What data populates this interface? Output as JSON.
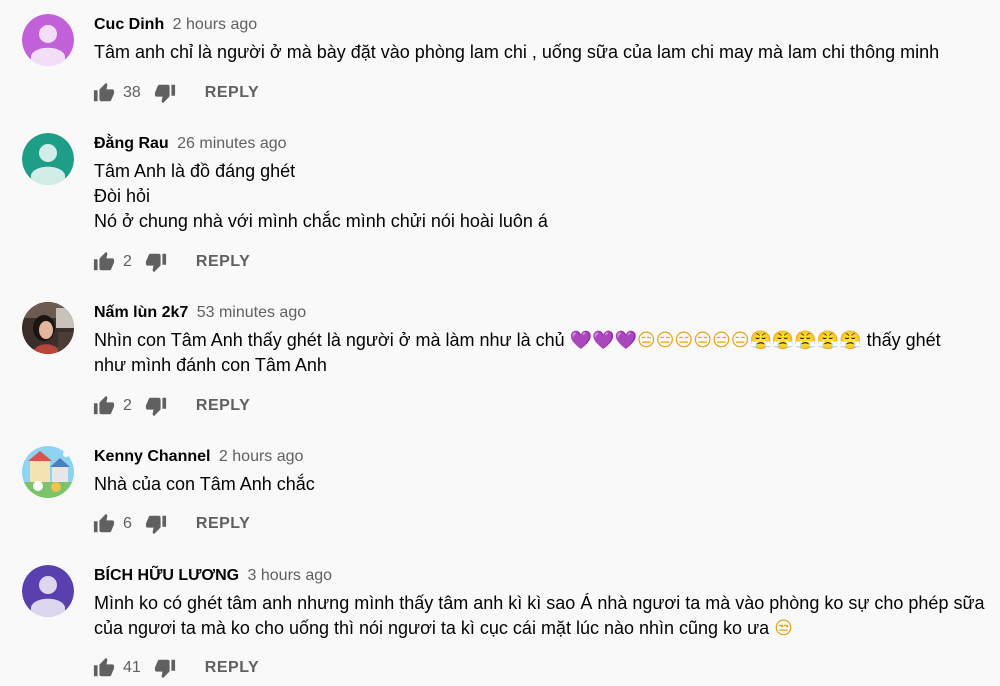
{
  "comments": [
    {
      "author": "Cuc Dinh",
      "time": "2 hours ago",
      "lines": [
        "Tâm anh chỉ là người ở mà bày  đặt vào phòng lam chi , uống sữa của lam chi may mà lam chi thông minh"
      ],
      "likes": "38",
      "reply": "REPLY",
      "avatar": {
        "type": "default",
        "bg": "#c160d8",
        "fg": "#f2def7"
      }
    },
    {
      "author": "Đằng Rau",
      "time": "26 minutes ago",
      "lines": [
        "Tâm Anh là đồ đáng ghét",
        "Đòi hỏi",
        "Nó ở chung nhà với mình chắc mình chửi nói hoài luôn á"
      ],
      "likes": "2",
      "reply": "REPLY",
      "avatar": {
        "type": "default",
        "bg": "#1e9e86",
        "fg": "#d2ede7"
      }
    },
    {
      "author": "Nấm lùn 2k7",
      "time": "53 minutes ago",
      "line1_text": "Nhìn con Tâm Anh thấy ghét là người ở mà làm như là chủ ",
      "line1_emoji": {
        "hearts": [
          "💜",
          "💜",
          "💜"
        ],
        "faces": [
          "😑",
          "😑",
          "😑",
          "😑",
          "😑",
          "😑",
          "😤",
          "😤",
          "😤",
          "😤",
          "😤"
        ]
      },
      "line1_tail": " thấy ghét",
      "line2": "như mình đánh con Tâm Anh",
      "likes": "2",
      "reply": "REPLY",
      "avatar": {
        "type": "photo"
      }
    },
    {
      "author": "Kenny Channel",
      "time": "2 hours ago",
      "lines": [
        "Nhà của con Tâm Anh chắc"
      ],
      "likes": "6",
      "reply": "REPLY",
      "avatar": {
        "type": "cartoon"
      }
    },
    {
      "author": "BÍCH HỮU LƯƠNG",
      "time": "3 hours ago",
      "lines": [
        "Mình ko có ghét tâm anh nhưng mình thấy tâm anh kì kì sao Á nhà ngươi ta mà vào phòng ko sự cho phép sữa"
      ],
      "line2_text": "của ngươi ta mà ko cho uống thì nói ngươi ta kì cục  cái mặt lúc nào nhìn cũng ko ưa ",
      "line2_emoji": "😒",
      "likes": "41",
      "reply": "REPLY",
      "avatar": {
        "type": "default",
        "bg": "#5a3fae",
        "fg": "#dcd6ef"
      }
    }
  ],
  "icons": {
    "like": "thumbs-up-icon",
    "dislike": "thumbs-down-icon"
  },
  "colors": {
    "background": "#f9f9f9",
    "text": "#030303",
    "secondary": "#606060"
  }
}
